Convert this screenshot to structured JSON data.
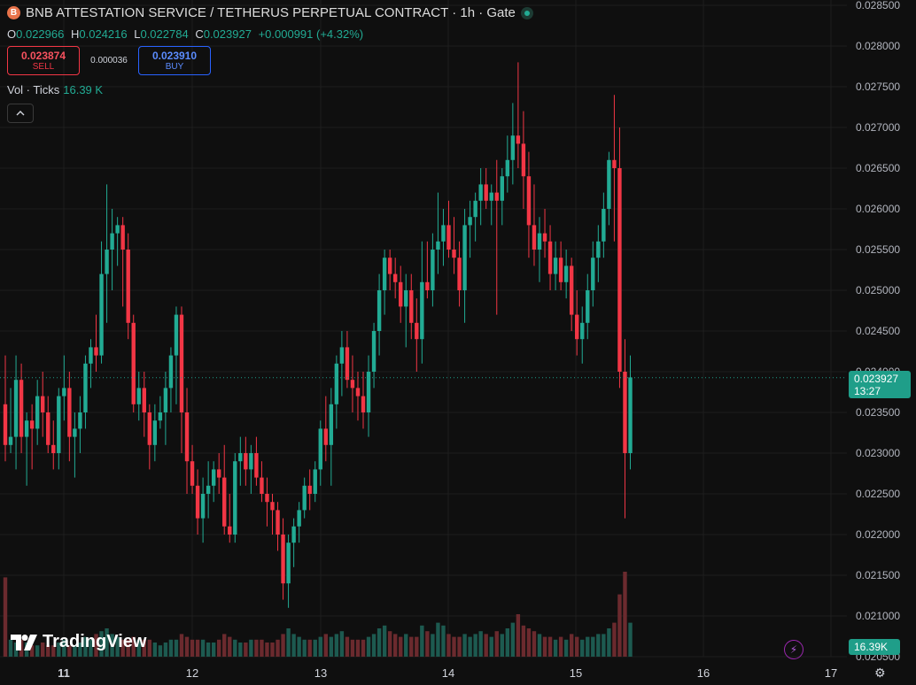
{
  "header": {
    "symbol_icon": "B",
    "title": "BNB ATTESTATION SERVICE / TETHERUS PERPETUAL CONTRACT · 1h · Gate",
    "ohlc": {
      "o_label": "O",
      "o": "0.022966",
      "h_label": "H",
      "h": "0.024216",
      "l_label": "L",
      "l": "0.022784",
      "c_label": "C",
      "c": "0.023927",
      "change": "+0.000991 (+4.32%)"
    }
  },
  "trade": {
    "sell_price": "0.023874",
    "sell_label": "SELL",
    "spread": "0.000036",
    "buy_price": "0.023910",
    "buy_label": "BUY"
  },
  "volume_legend": {
    "label": "Vol · Ticks",
    "value": "16.39 K"
  },
  "logo_text": "TradingView",
  "last_price": {
    "price": "0.023927",
    "countdown": "13:27"
  },
  "last_volume": "16.39K",
  "colors": {
    "up": "#22ab94",
    "down": "#f23645",
    "up_vol": "#1d5a50",
    "down_vol": "#6b2a2e",
    "background": "#0f0f0f",
    "grid": "#1e1e1e"
  },
  "chart_data": {
    "type": "candlestick",
    "interval": "1h",
    "y_range": [
      0.0205,
      0.0285
    ],
    "y_ticks": [
      "0.028500",
      "0.028000",
      "0.027500",
      "0.027000",
      "0.026500",
      "0.026000",
      "0.025500",
      "0.025000",
      "0.024500",
      "0.024000",
      "0.023500",
      "0.023000",
      "0.022500",
      "0.022000",
      "0.021500",
      "0.021000",
      "0.020500"
    ],
    "x_ticks": [
      "11",
      "12",
      "13",
      "14",
      "15",
      "16",
      "17"
    ],
    "ohlc": [
      [
        0.0236,
        0.0242,
        0.0229,
        0.0231
      ],
      [
        0.0231,
        0.0238,
        0.023,
        0.0232
      ],
      [
        0.0232,
        0.0242,
        0.0228,
        0.0239
      ],
      [
        0.0239,
        0.0241,
        0.023,
        0.0232
      ],
      [
        0.0232,
        0.0235,
        0.0226,
        0.0234
      ],
      [
        0.0234,
        0.0236,
        0.0228,
        0.0233
      ],
      [
        0.0233,
        0.0239,
        0.0231,
        0.0237
      ],
      [
        0.0237,
        0.024,
        0.0232,
        0.0235
      ],
      [
        0.0235,
        0.0237,
        0.023,
        0.0231
      ],
      [
        0.0231,
        0.0234,
        0.0228,
        0.023
      ],
      [
        0.023,
        0.0238,
        0.0228,
        0.0237
      ],
      [
        0.0237,
        0.0242,
        0.0234,
        0.0238
      ],
      [
        0.0238,
        0.024,
        0.0229,
        0.0232
      ],
      [
        0.0232,
        0.0235,
        0.0227,
        0.0233
      ],
      [
        0.0233,
        0.0237,
        0.023,
        0.0235
      ],
      [
        0.0235,
        0.0242,
        0.0233,
        0.0241
      ],
      [
        0.0241,
        0.0244,
        0.0238,
        0.0243
      ],
      [
        0.0243,
        0.0247,
        0.024,
        0.0242
      ],
      [
        0.0242,
        0.0256,
        0.0241,
        0.0252
      ],
      [
        0.0252,
        0.0263,
        0.0246,
        0.0255
      ],
      [
        0.0255,
        0.026,
        0.025,
        0.0257
      ],
      [
        0.0257,
        0.0259,
        0.0253,
        0.0258
      ],
      [
        0.0258,
        0.0259,
        0.0248,
        0.0255
      ],
      [
        0.0255,
        0.0257,
        0.0244,
        0.0246
      ],
      [
        0.0246,
        0.0247,
        0.0235,
        0.0236
      ],
      [
        0.0236,
        0.024,
        0.0234,
        0.0238
      ],
      [
        0.0238,
        0.024,
        0.0232,
        0.0235
      ],
      [
        0.0235,
        0.0236,
        0.0228,
        0.0231
      ],
      [
        0.0231,
        0.0236,
        0.0229,
        0.0234
      ],
      [
        0.0234,
        0.0237,
        0.0233,
        0.0235
      ],
      [
        0.0235,
        0.024,
        0.0231,
        0.0238
      ],
      [
        0.0238,
        0.0243,
        0.0235,
        0.0242
      ],
      [
        0.0242,
        0.0248,
        0.0236,
        0.0247
      ],
      [
        0.0247,
        0.0248,
        0.023,
        0.0235
      ],
      [
        0.0235,
        0.0238,
        0.0225,
        0.0229
      ],
      [
        0.0229,
        0.0231,
        0.0225,
        0.0226
      ],
      [
        0.0226,
        0.0228,
        0.022,
        0.0222
      ],
      [
        0.0222,
        0.0227,
        0.0219,
        0.0225
      ],
      [
        0.0225,
        0.0229,
        0.0222,
        0.0226
      ],
      [
        0.0226,
        0.0229,
        0.0224,
        0.0228
      ],
      [
        0.0228,
        0.023,
        0.0225,
        0.0227
      ],
      [
        0.0227,
        0.0231,
        0.022,
        0.0221
      ],
      [
        0.0221,
        0.0225,
        0.0219,
        0.022
      ],
      [
        0.022,
        0.023,
        0.0219,
        0.0229
      ],
      [
        0.0229,
        0.0232,
        0.0226,
        0.023
      ],
      [
        0.023,
        0.0232,
        0.0226,
        0.0228
      ],
      [
        0.0228,
        0.0231,
        0.0225,
        0.023
      ],
      [
        0.023,
        0.0232,
        0.0226,
        0.0227
      ],
      [
        0.0227,
        0.0229,
        0.0224,
        0.0225
      ],
      [
        0.0225,
        0.0227,
        0.0221,
        0.0224
      ],
      [
        0.0224,
        0.0225,
        0.022,
        0.0223
      ],
      [
        0.0223,
        0.0224,
        0.0218,
        0.022
      ],
      [
        0.022,
        0.0222,
        0.0212,
        0.0214
      ],
      [
        0.0214,
        0.022,
        0.0211,
        0.0219
      ],
      [
        0.0219,
        0.0222,
        0.0216,
        0.0221
      ],
      [
        0.0221,
        0.0224,
        0.0219,
        0.0223
      ],
      [
        0.0223,
        0.0227,
        0.0222,
        0.0226
      ],
      [
        0.0226,
        0.0228,
        0.0223,
        0.0225
      ],
      [
        0.0225,
        0.0229,
        0.0224,
        0.0228
      ],
      [
        0.0228,
        0.0234,
        0.0226,
        0.0233
      ],
      [
        0.0233,
        0.0237,
        0.0229,
        0.0231
      ],
      [
        0.0231,
        0.0238,
        0.0226,
        0.0236
      ],
      [
        0.0236,
        0.0242,
        0.0233,
        0.0241
      ],
      [
        0.0241,
        0.0245,
        0.0237,
        0.0243
      ],
      [
        0.0243,
        0.0245,
        0.0238,
        0.0239
      ],
      [
        0.0239,
        0.0242,
        0.0235,
        0.0238
      ],
      [
        0.0238,
        0.024,
        0.0234,
        0.0237
      ],
      [
        0.0237,
        0.024,
        0.0233,
        0.0235
      ],
      [
        0.0235,
        0.0242,
        0.0232,
        0.024
      ],
      [
        0.024,
        0.0246,
        0.0238,
        0.0245
      ],
      [
        0.0245,
        0.0252,
        0.0242,
        0.025
      ],
      [
        0.025,
        0.0255,
        0.0247,
        0.0254
      ],
      [
        0.0254,
        0.0255,
        0.025,
        0.0252
      ],
      [
        0.0252,
        0.0254,
        0.0249,
        0.0251
      ],
      [
        0.0251,
        0.0253,
        0.0246,
        0.0248
      ],
      [
        0.0248,
        0.0252,
        0.0243,
        0.025
      ],
      [
        0.025,
        0.0252,
        0.0244,
        0.0246
      ],
      [
        0.0246,
        0.0249,
        0.024,
        0.0244
      ],
      [
        0.0244,
        0.0256,
        0.0241,
        0.0251
      ],
      [
        0.0251,
        0.0256,
        0.0249,
        0.025
      ],
      [
        0.025,
        0.0257,
        0.0248,
        0.0255
      ],
      [
        0.0255,
        0.0262,
        0.0252,
        0.0256
      ],
      [
        0.0256,
        0.026,
        0.0253,
        0.0258
      ],
      [
        0.0258,
        0.0261,
        0.0254,
        0.0255
      ],
      [
        0.0255,
        0.0259,
        0.0252,
        0.0254
      ],
      [
        0.0254,
        0.0256,
        0.0248,
        0.025
      ],
      [
        0.025,
        0.026,
        0.0246,
        0.0258
      ],
      [
        0.0258,
        0.0261,
        0.0254,
        0.0259
      ],
      [
        0.0259,
        0.0262,
        0.0256,
        0.0261
      ],
      [
        0.0261,
        0.0265,
        0.0258,
        0.0263
      ],
      [
        0.0263,
        0.0265,
        0.026,
        0.0261
      ],
      [
        0.0261,
        0.0263,
        0.0258,
        0.0262
      ],
      [
        0.0262,
        0.0266,
        0.0247,
        0.0261
      ],
      [
        0.0261,
        0.0265,
        0.0258,
        0.0264
      ],
      [
        0.0264,
        0.0269,
        0.0262,
        0.0266
      ],
      [
        0.0266,
        0.0273,
        0.0263,
        0.0269
      ],
      [
        0.0269,
        0.0278,
        0.0265,
        0.0268
      ],
      [
        0.0268,
        0.0272,
        0.026,
        0.0264
      ],
      [
        0.0264,
        0.0267,
        0.0254,
        0.0258
      ],
      [
        0.0258,
        0.0263,
        0.0253,
        0.0255
      ],
      [
        0.0255,
        0.0259,
        0.0251,
        0.0257
      ],
      [
        0.0257,
        0.026,
        0.0254,
        0.0256
      ],
      [
        0.0256,
        0.0258,
        0.025,
        0.0252
      ],
      [
        0.0252,
        0.0256,
        0.025,
        0.0254
      ],
      [
        0.0254,
        0.0256,
        0.025,
        0.0251
      ],
      [
        0.0251,
        0.0255,
        0.0249,
        0.0253
      ],
      [
        0.0253,
        0.0254,
        0.0245,
        0.0247
      ],
      [
        0.0247,
        0.025,
        0.0242,
        0.0244
      ],
      [
        0.0244,
        0.0248,
        0.0241,
        0.0246
      ],
      [
        0.0246,
        0.0252,
        0.0244,
        0.025
      ],
      [
        0.025,
        0.0256,
        0.0248,
        0.0254
      ],
      [
        0.0254,
        0.0258,
        0.0251,
        0.0256
      ],
      [
        0.0256,
        0.0262,
        0.0254,
        0.026
      ],
      [
        0.026,
        0.0267,
        0.0258,
        0.0266
      ],
      [
        0.0266,
        0.0274,
        0.0256,
        0.0265
      ],
      [
        0.0265,
        0.027,
        0.0238,
        0.024
      ],
      [
        0.024,
        0.0244,
        0.0222,
        0.023
      ],
      [
        0.023,
        0.0242,
        0.0228,
        0.02393
      ]
    ],
    "volume": [
      1.4,
      0.3,
      0.25,
      0.3,
      0.25,
      0.2,
      0.2,
      0.25,
      0.2,
      0.2,
      0.25,
      0.3,
      0.2,
      0.2,
      0.25,
      0.35,
      0.3,
      0.4,
      0.45,
      0.5,
      0.4,
      0.35,
      0.3,
      0.3,
      0.35,
      0.3,
      0.3,
      0.3,
      0.25,
      0.2,
      0.25,
      0.3,
      0.3,
      0.4,
      0.35,
      0.3,
      0.3,
      0.3,
      0.25,
      0.25,
      0.3,
      0.4,
      0.35,
      0.3,
      0.25,
      0.25,
      0.3,
      0.3,
      0.3,
      0.25,
      0.25,
      0.3,
      0.4,
      0.5,
      0.4,
      0.35,
      0.3,
      0.3,
      0.3,
      0.35,
      0.4,
      0.35,
      0.4,
      0.45,
      0.35,
      0.3,
      0.3,
      0.3,
      0.35,
      0.4,
      0.5,
      0.55,
      0.45,
      0.4,
      0.35,
      0.4,
      0.35,
      0.35,
      0.55,
      0.45,
      0.4,
      0.6,
      0.55,
      0.4,
      0.35,
      0.35,
      0.4,
      0.35,
      0.4,
      0.45,
      0.4,
      0.35,
      0.45,
      0.4,
      0.5,
      0.6,
      0.75,
      0.55,
      0.5,
      0.45,
      0.4,
      0.35,
      0.35,
      0.3,
      0.35,
      0.3,
      0.4,
      0.35,
      0.3,
      0.35,
      0.35,
      0.4,
      0.4,
      0.5,
      0.6,
      1.1,
      1.5,
      0.6
    ]
  }
}
